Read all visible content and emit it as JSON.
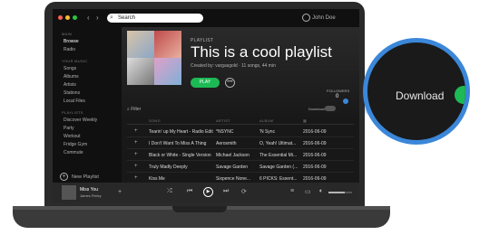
{
  "topbar": {
    "search_placeholder": "Search",
    "user_name": "John Doe"
  },
  "sidebar": {
    "main_heading": "MAIN",
    "main_items": [
      {
        "label": "Browse"
      },
      {
        "label": "Radio"
      }
    ],
    "music_heading": "YOUR MUSIC",
    "music_items": [
      {
        "label": "Songs"
      },
      {
        "label": "Albums"
      },
      {
        "label": "Artists"
      },
      {
        "label": "Stations"
      },
      {
        "label": "Local Files"
      }
    ],
    "playlists_heading": "PLAYLISTS",
    "playlist_items": [
      {
        "label": "Discover Weekly"
      },
      {
        "label": "Party"
      },
      {
        "label": "Workout"
      },
      {
        "label": "Fridge Gym"
      },
      {
        "label": "Commute"
      }
    ],
    "new_playlist": "New Playlist"
  },
  "playlist": {
    "type_label": "PLAYLIST",
    "title": "This is a cool playlist",
    "meta": "Created by: vargasgold · 11 songs, 44 min",
    "play_label": "PLAY",
    "more_label": "•••",
    "followers_label": "FOLLOWERS",
    "followers_count": "0",
    "filter_label": "Filter",
    "download_label": "Download"
  },
  "table": {
    "headers": {
      "song": "SONG",
      "artist": "ARTIST",
      "album": "ALBUM",
      "date_icon": "calendar-icon"
    },
    "rows": [
      {
        "song": "Tearin' up My Heart - Radio Edit",
        "artist": "*NSYNC",
        "album": "'N Sync",
        "date": "2016-06-09"
      },
      {
        "song": "I Don't Want To Miss A Thing",
        "artist": "Aerosmith",
        "album": "O, Yeah! Ultimat...",
        "date": "2016-06-09"
      },
      {
        "song": "Black or White - Single Version",
        "artist": "Michael Jackson",
        "album": "The Essential Mi...",
        "date": "2016-06-09"
      },
      {
        "song": "Truly Madly Deeply",
        "artist": "Savage Garden",
        "album": "Savage Garden (...",
        "date": "2016-06-09"
      },
      {
        "song": "Kiss Me",
        "artist": "Sixpence None...",
        "album": "6 PICKS: Essent...",
        "date": "2016-06-09"
      }
    ]
  },
  "now_playing": {
    "title": "Miss You",
    "artist": "James Fieley"
  },
  "lens": {
    "label": "Download",
    "toggle_on": true
  },
  "colors": {
    "accent": "#1db954",
    "lens_ring": "#3b87d9",
    "background": "#181818"
  }
}
